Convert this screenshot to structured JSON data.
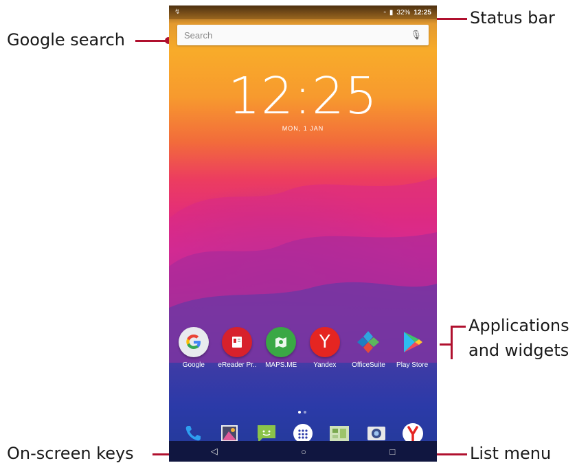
{
  "callouts": {
    "status_bar": "Status bar",
    "google_search": "Google search",
    "applications_line1": "Applications",
    "applications_line2": "and widgets",
    "on_screen_keys": "On-screen keys",
    "list_menu": "List menu"
  },
  "colors": {
    "callout_line": "#b0102e"
  },
  "status": {
    "battery": "32%",
    "time": "12:25",
    "icons": [
      "sim-icon",
      "battery-icon"
    ]
  },
  "search": {
    "placeholder": "Search",
    "mic_icon": "microphone-icon"
  },
  "clock": {
    "time": "12:25",
    "date": "MON, 1 JAN"
  },
  "apps": [
    {
      "label": "Google",
      "icon": "google-icon",
      "color": "#e8eaee"
    },
    {
      "label": "eReader Pr..",
      "icon": "ereader-icon",
      "color": "#d7212c"
    },
    {
      "label": "MAPS.ME",
      "icon": "maps-icon",
      "color": "#3aa845"
    },
    {
      "label": "Yandex",
      "icon": "yandex-icon",
      "color": "#e52521"
    },
    {
      "label": "OfficeSuite",
      "icon": "officesuite-icon",
      "color": "#ffffff"
    },
    {
      "label": "Play Store",
      "icon": "play-store-icon",
      "color": "#ffffff"
    }
  ],
  "dock": [
    "phone-icon",
    "gallery-icon",
    "messaging-icon",
    "app-drawer-icon",
    "widgets-icon",
    "camera-icon",
    "yandex-browser-icon"
  ],
  "nav": {
    "back": "◁",
    "home": "○",
    "recents": "□"
  }
}
